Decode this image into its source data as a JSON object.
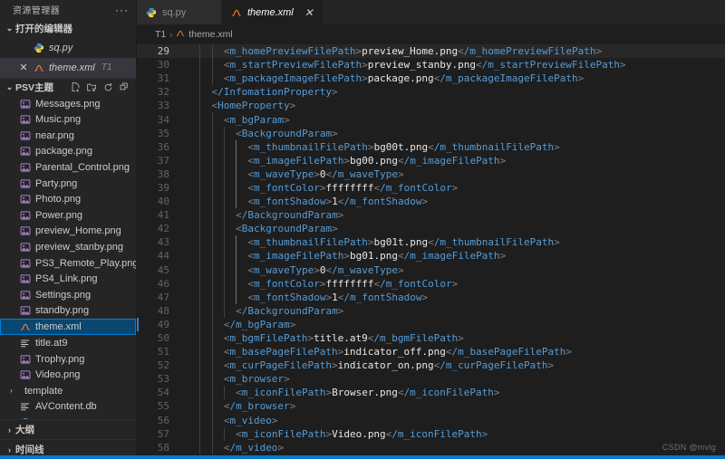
{
  "sidebar": {
    "title": "资源管理器",
    "more_label": "···",
    "open_editors": {
      "label": "打开的编辑器",
      "twisty": "⌄",
      "items": [
        {
          "name": "sq.py",
          "icon": "python-file-icon",
          "suffix": "",
          "active": false,
          "close": ""
        },
        {
          "name": "theme.xml",
          "icon": "xml-file-icon",
          "suffix": "T1",
          "active": true,
          "close": "✕"
        }
      ]
    },
    "folder": {
      "label": "PSV主题",
      "twisty": "⌄",
      "actions": [
        {
          "name": "new-file-icon",
          "title": "新建文件"
        },
        {
          "name": "new-folder-icon",
          "title": "新建文件夹"
        },
        {
          "name": "refresh-icon",
          "title": "刷新资源管理器"
        },
        {
          "name": "collapse-all-icon",
          "title": "在资源管理器中折叠文件夹"
        }
      ],
      "files": [
        {
          "name": "Messages.png",
          "icon": "image-file-icon",
          "type": "file",
          "selected": false
        },
        {
          "name": "Music.png",
          "icon": "image-file-icon",
          "type": "file",
          "selected": false
        },
        {
          "name": "near.png",
          "icon": "image-file-icon",
          "type": "file",
          "selected": false
        },
        {
          "name": "package.png",
          "icon": "image-file-icon",
          "type": "file",
          "selected": false
        },
        {
          "name": "Parental_Control.png",
          "icon": "image-file-icon",
          "type": "file",
          "selected": false
        },
        {
          "name": "Party.png",
          "icon": "image-file-icon",
          "type": "file",
          "selected": false
        },
        {
          "name": "Photo.png",
          "icon": "image-file-icon",
          "type": "file",
          "selected": false
        },
        {
          "name": "Power.png",
          "icon": "image-file-icon",
          "type": "file",
          "selected": false
        },
        {
          "name": "preview_Home.png",
          "icon": "image-file-icon",
          "type": "file",
          "selected": false
        },
        {
          "name": "preview_stanby.png",
          "icon": "image-file-icon",
          "type": "file",
          "selected": false
        },
        {
          "name": "PS3_Remote_Play.png",
          "icon": "image-file-icon",
          "type": "file",
          "selected": false
        },
        {
          "name": "PS4_Link.png",
          "icon": "image-file-icon",
          "type": "file",
          "selected": false
        },
        {
          "name": "Settings.png",
          "icon": "image-file-icon",
          "type": "file",
          "selected": false
        },
        {
          "name": "standby.png",
          "icon": "image-file-icon",
          "type": "file",
          "selected": false
        },
        {
          "name": "theme.xml",
          "icon": "xml-file-icon",
          "type": "file",
          "selected": true
        },
        {
          "name": "title.at9",
          "icon": "audio-file-icon",
          "type": "file",
          "selected": false
        },
        {
          "name": "Trophy.png",
          "icon": "image-file-icon",
          "type": "file",
          "selected": false
        },
        {
          "name": "Video.png",
          "icon": "image-file-icon",
          "type": "file",
          "selected": false
        },
        {
          "name": "template",
          "icon": "folder-icon",
          "type": "folder",
          "twisty": "›",
          "selected": false
        },
        {
          "name": "AVContent.db",
          "icon": "database-file-icon",
          "type": "file",
          "selected": false
        },
        {
          "name": "sq.py",
          "icon": "python-file-icon",
          "type": "file",
          "selected": false
        }
      ]
    },
    "collapsed_sections": [
      {
        "label": "大纲",
        "twisty": "›"
      },
      {
        "label": "时间线",
        "twisty": "›"
      }
    ]
  },
  "tabs": [
    {
      "label": "sq.py",
      "icon": "python-file-icon",
      "active": false,
      "close": ""
    },
    {
      "label": "theme.xml",
      "icon": "xml-file-icon",
      "active": true,
      "close": "✕"
    }
  ],
  "breadcrumb": {
    "root": "T1",
    "separator": "›",
    "file": "theme.xml",
    "file_icon": "xml-file-icon"
  },
  "editor": {
    "current_line": 29,
    "lines": [
      {
        "n": 29,
        "indent": 3,
        "text": "<m_homePreviewFilePath>preview_Home.png</m_homePreviewFilePath>"
      },
      {
        "n": 30,
        "indent": 3,
        "text": "<m_startPreviewFilePath>preview_stanby.png</m_startPreviewFilePath>"
      },
      {
        "n": 31,
        "indent": 3,
        "text": "<m_packageImageFilePath>package.png</m_packageImageFilePath>"
      },
      {
        "n": 32,
        "indent": 2,
        "text": "</InfomationProperty>"
      },
      {
        "n": 33,
        "indent": 2,
        "text": "<HomeProperty>"
      },
      {
        "n": 34,
        "indent": 3,
        "text": "<m_bgParam>"
      },
      {
        "n": 35,
        "indent": 4,
        "text": "<BackgroundParam>"
      },
      {
        "n": 36,
        "indent": 5,
        "text": "<m_thumbnailFilePath>bg00t.png</m_thumbnailFilePath>"
      },
      {
        "n": 37,
        "indent": 5,
        "text": "<m_imageFilePath>bg00.png</m_imageFilePath>"
      },
      {
        "n": 38,
        "indent": 5,
        "text": "<m_waveType>0</m_waveType>"
      },
      {
        "n": 39,
        "indent": 5,
        "text": "<m_fontColor>ffffffff</m_fontColor>"
      },
      {
        "n": 40,
        "indent": 5,
        "text": "<m_fontShadow>1</m_fontShadow>"
      },
      {
        "n": 41,
        "indent": 4,
        "text": "</BackgroundParam>"
      },
      {
        "n": 42,
        "indent": 4,
        "text": "<BackgroundParam>"
      },
      {
        "n": 43,
        "indent": 5,
        "text": "<m_thumbnailFilePath>bg01t.png</m_thumbnailFilePath>"
      },
      {
        "n": 44,
        "indent": 5,
        "text": "<m_imageFilePath>bg01.png</m_imageFilePath>"
      },
      {
        "n": 45,
        "indent": 5,
        "text": "<m_waveType>0</m_waveType>"
      },
      {
        "n": 46,
        "indent": 5,
        "text": "<m_fontColor>ffffffff</m_fontColor>"
      },
      {
        "n": 47,
        "indent": 5,
        "text": "<m_fontShadow>1</m_fontShadow>"
      },
      {
        "n": 48,
        "indent": 4,
        "text": "</BackgroundParam>"
      },
      {
        "n": 49,
        "indent": 3,
        "text": "</m_bgParam>"
      },
      {
        "n": 50,
        "indent": 3,
        "text": "<m_bgmFilePath>title.at9</m_bgmFilePath>"
      },
      {
        "n": 51,
        "indent": 3,
        "text": "<m_basePageFilePath>indicator_off.png</m_basePageFilePath>"
      },
      {
        "n": 52,
        "indent": 3,
        "text": "<m_curPageFilePath>indicator_on.png</m_curPageFilePath>"
      },
      {
        "n": 53,
        "indent": 3,
        "text": "<m_browser>"
      },
      {
        "n": 54,
        "indent": 4,
        "text": "<m_iconFilePath>Browser.png</m_iconFilePath>"
      },
      {
        "n": 55,
        "indent": 3,
        "text": "</m_browser>"
      },
      {
        "n": 56,
        "indent": 3,
        "text": "<m_video>"
      },
      {
        "n": 57,
        "indent": 4,
        "text": "<m_iconFilePath>Video.png</m_iconFilePath>"
      },
      {
        "n": 58,
        "indent": 3,
        "text": "</m_video>"
      }
    ]
  },
  "watermark": "CSDN @mvlg",
  "colors": {
    "accent": "#007acc",
    "selection": "#094771",
    "selection_border": "#007fd4",
    "tag": "#569cd6",
    "bracket": "#808080",
    "sidebar_bg": "#252526",
    "editor_bg": "#1e1e1e"
  }
}
